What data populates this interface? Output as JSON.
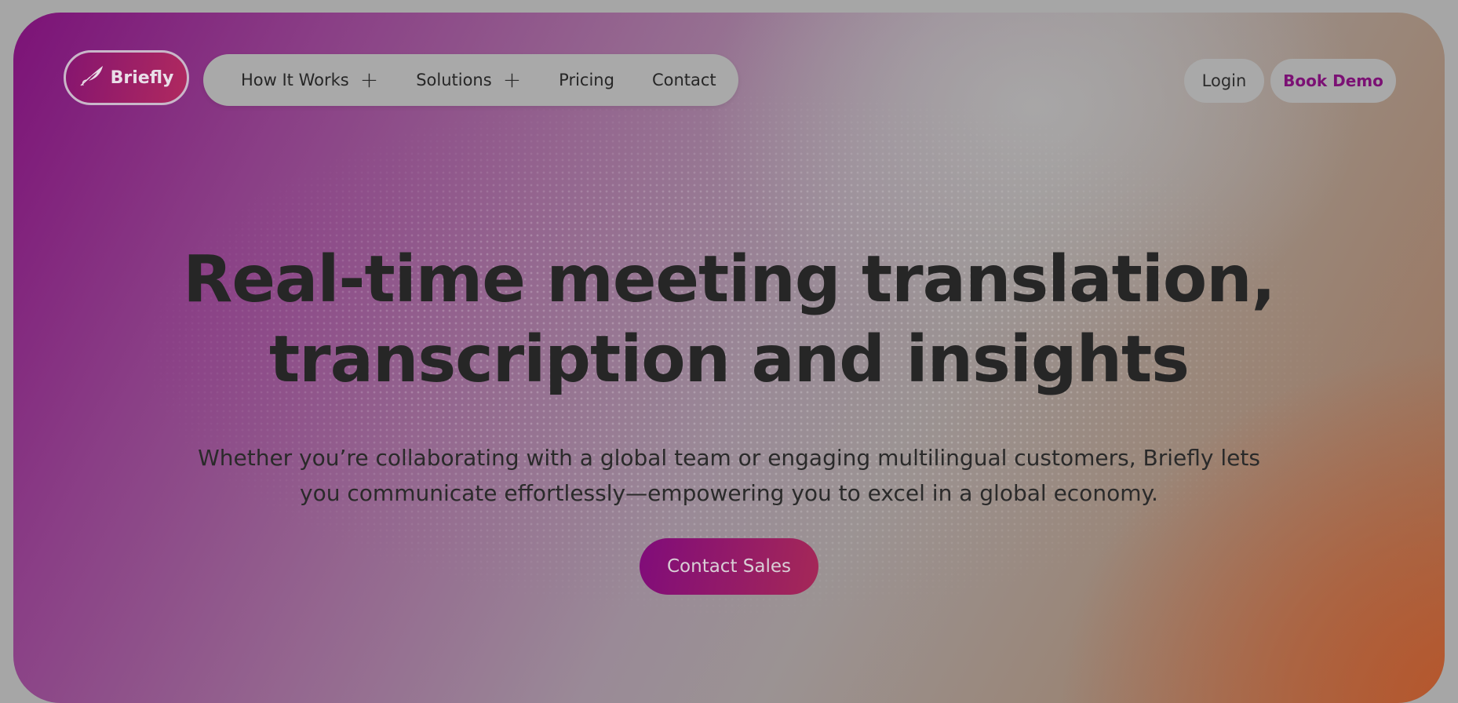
{
  "brand": {
    "name": "Briefly",
    "logo_icon": "feather-icon"
  },
  "nav": {
    "items": [
      {
        "label": "How It Works",
        "icon": "plus-icon"
      },
      {
        "label": "Solutions",
        "icon": "plus-icon"
      },
      {
        "label": "Pricing"
      },
      {
        "label": "Contact"
      }
    ],
    "login_label": "Login",
    "demo_label": "Book Demo"
  },
  "hero": {
    "headline_line1": "Real-time meeting translation,",
    "headline_line2": "transcription and insights",
    "sub_line1": "Whether you’re collaborating with a global team or engaging multilingual customers, Briefly lets",
    "sub_line2": "you communicate effortlessly—empowering you to excel in a global economy.",
    "cta_label": "Contact Sales"
  },
  "colors": {
    "accent": "#7b1174",
    "brand_gradient_start": "#86156f",
    "brand_gradient_end": "#b0295f",
    "text_dark": "#262626"
  }
}
